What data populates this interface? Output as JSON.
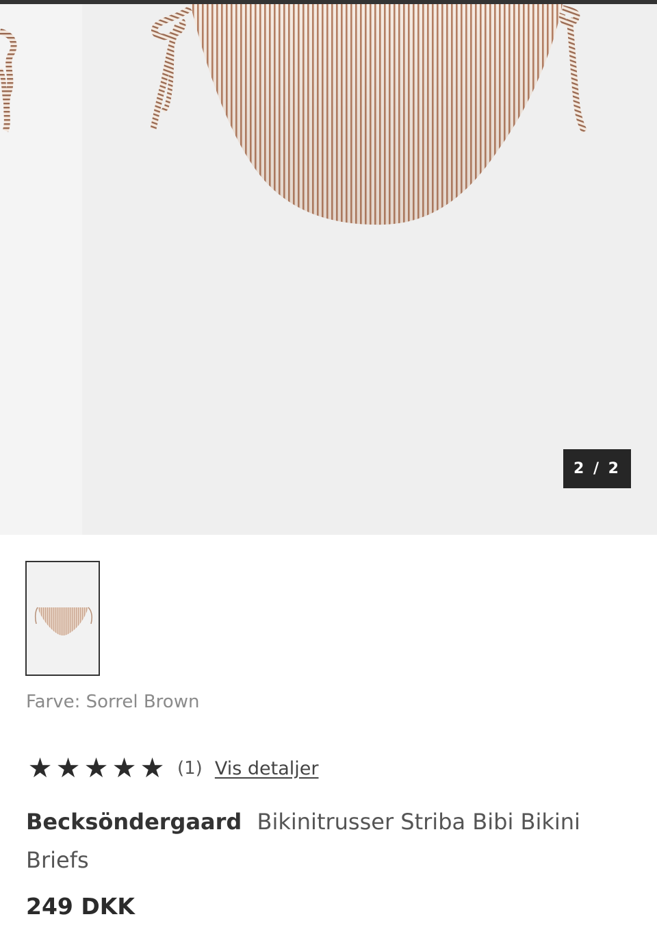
{
  "gallery": {
    "counter": "2 / 2",
    "current_slide": 2,
    "total_slides": 2
  },
  "thumbnail": {
    "icon": "product-thumbnail"
  },
  "product": {
    "color_label": "Farve: Sorrel Brown",
    "rating": {
      "stars": 5,
      "star_glyph": "★",
      "count_text": "(1)",
      "details_link": "Vis detaljer"
    },
    "brand": "Becksöndergaard",
    "name": "Bikinitrusser Striba Bibi Bikini Briefs",
    "price": "249 DKK"
  },
  "colors": {
    "stripe_light": "#f3e6dc",
    "stripe_dark": "#b07a5e",
    "counter_bg": "#262626"
  }
}
